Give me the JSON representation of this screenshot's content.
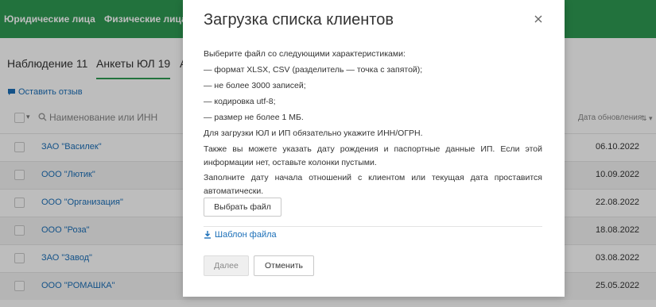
{
  "topnav": {
    "items": [
      "Юридические лица",
      "Физические лица"
    ]
  },
  "tabs": [
    "Наблюдение 11",
    "Анкеты ЮЛ 19",
    "А"
  ],
  "feedback_label": "Оставить отзыв",
  "table": {
    "name_header": "Наименование или ИНН",
    "date_header": "Дата обновления",
    "rows": [
      {
        "name": "ЗАО \"Василек\"",
        "date": "06.10.2022"
      },
      {
        "name": "ООО \"Лютик\"",
        "date": "10.09.2022"
      },
      {
        "name": "ООО \"Организация\"",
        "date": "22.08.2022"
      },
      {
        "name": "ООО \"Роза\"",
        "date": "18.08.2022"
      },
      {
        "name": "ЗАО \"Завод\"",
        "date": "03.08.2022"
      },
      {
        "name": "ООО \"РОМАШКА\"",
        "date": "25.05.2022"
      }
    ]
  },
  "modal": {
    "title": "Загрузка списка клиентов",
    "intro": "Выберите файл со следующими характеристиками:",
    "requirements": [
      "— формат XLSX, CSV (разделитель — точка с запятой);",
      "— не более 3000 записей;",
      "— кодировка utf-8;",
      "— размер не более 1 МБ."
    ],
    "inn_note": "Для загрузки ЮЛ и ИП обязательно укажите ИНН/ОГРН.",
    "birth_note": "Также вы можете указать дату рождения и паспортные данные ИП. Если этой информации нет, оставьте колонки пустыми.",
    "date_note": "Заполните дату начала отношений с клиентом или текущая дата проставится автоматически.",
    "choose_file": "Выбрать файл",
    "template_link": "Шаблон файла",
    "next": "Далее",
    "cancel": "Отменить"
  },
  "colors": {
    "brand_green": "#2e9a53",
    "link_blue": "#1b6fb8"
  }
}
